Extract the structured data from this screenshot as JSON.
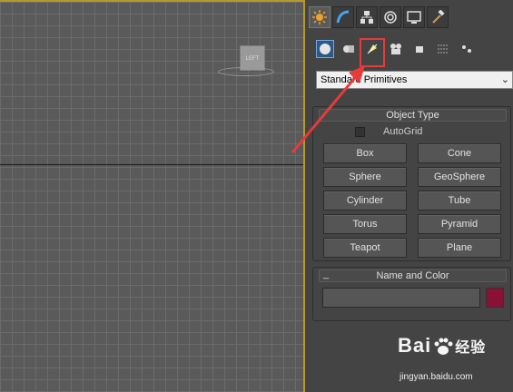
{
  "viewport": {
    "viewcube_label": "LEFT"
  },
  "command_panel": {
    "tabs": [
      {
        "name": "create",
        "icon": "create-sun-icon",
        "active": true
      },
      {
        "name": "modify",
        "icon": "modify-arc-icon"
      },
      {
        "name": "hierarchy",
        "icon": "hierarchy-icon"
      },
      {
        "name": "motion",
        "icon": "motion-icon"
      },
      {
        "name": "display",
        "icon": "display-monitor-icon"
      },
      {
        "name": "utilities",
        "icon": "utilities-hammer-icon"
      }
    ],
    "create_categories": [
      {
        "name": "geometry",
        "icon": "geometry-sphere-icon",
        "active": true
      },
      {
        "name": "shapes",
        "icon": "shapes-icon"
      },
      {
        "name": "lights",
        "icon": "lights-icon",
        "highlighted": true
      },
      {
        "name": "cameras",
        "icon": "cameras-icon"
      },
      {
        "name": "helpers",
        "icon": "helpers-icon"
      },
      {
        "name": "space_warps",
        "icon": "space-warps-icon"
      },
      {
        "name": "systems",
        "icon": "systems-icon"
      }
    ],
    "dropdown_value": "Standard Primitives",
    "object_type": {
      "title": "Object Type",
      "autogrid_label": "AutoGrid",
      "buttons": [
        "Box",
        "Cone",
        "Sphere",
        "GeoSphere",
        "Cylinder",
        "Tube",
        "Torus",
        "Pyramid",
        "Teapot",
        "Plane"
      ]
    },
    "name_and_color": {
      "collapse_symbol": "_",
      "title": "Name and Color",
      "name_value": "",
      "color": "#8b1038"
    }
  },
  "annotation": {
    "highlight_color": "#e53b3b"
  },
  "watermark": {
    "brand": "Bai",
    "brand_suffix": "经验",
    "url": "jingyan.baidu.com"
  }
}
